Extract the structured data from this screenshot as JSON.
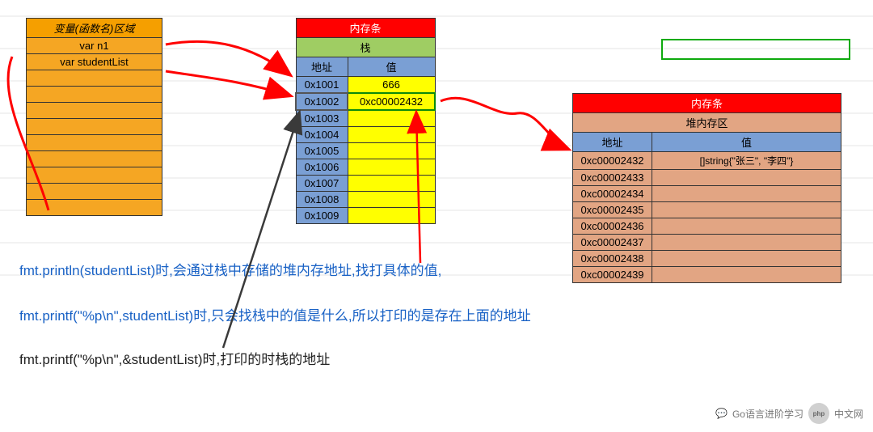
{
  "left": {
    "title": "变量(函数名)区域",
    "rows": [
      "var n1",
      "var studentList",
      "",
      "",
      "",
      "",
      "",
      "",
      "",
      "",
      "",
      ""
    ]
  },
  "mid": {
    "banner": "内存条",
    "section": "栈",
    "hdr_addr": "地址",
    "hdr_val": "值",
    "rows": [
      {
        "addr": "0x1001",
        "val": "666"
      },
      {
        "addr": "0x1002",
        "val": "0xc00002432",
        "hl": true
      },
      {
        "addr": "0x1003",
        "val": ""
      },
      {
        "addr": "0x1004",
        "val": ""
      },
      {
        "addr": "0x1005",
        "val": ""
      },
      {
        "addr": "0x1006",
        "val": ""
      },
      {
        "addr": "0x1007",
        "val": ""
      },
      {
        "addr": "0x1008",
        "val": ""
      },
      {
        "addr": "0x1009",
        "val": ""
      }
    ]
  },
  "right": {
    "banner": "内存条",
    "section": "堆内存区",
    "hdr_addr": "地址",
    "hdr_val": "值",
    "rows": [
      {
        "addr": "0xc00002432",
        "val": "[]string{\"张三\", \"李四\"}"
      },
      {
        "addr": "0xc00002433",
        "val": ""
      },
      {
        "addr": "0xc00002434",
        "val": ""
      },
      {
        "addr": "0xc00002435",
        "val": ""
      },
      {
        "addr": "0xc00002436",
        "val": ""
      },
      {
        "addr": "0xc00002437",
        "val": ""
      },
      {
        "addr": "0xc00002438",
        "val": ""
      },
      {
        "addr": "0xc00002439",
        "val": ""
      }
    ]
  },
  "captions": {
    "line1": "fmt.println(studentList)时,会通过栈中存储的堆内存地址,找打具体的值,",
    "line2": "fmt.printf(\"%p\\n\",studentList)时,只会找栈中的值是什么,所以打印的是存在上面的地址",
    "line3": "fmt.printf(\"%p\\n\",&studentList)时,打印的时栈的地址"
  },
  "footer": {
    "brand": "Go语言进阶学习",
    "site": "中文网",
    "php": "php"
  }
}
